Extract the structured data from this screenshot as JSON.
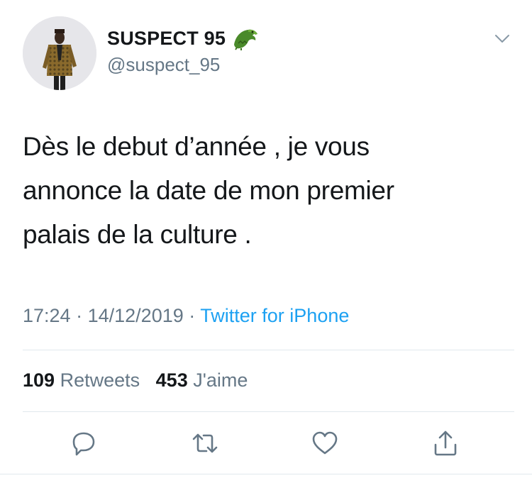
{
  "tweet": {
    "author_name": "SUSPECT 95",
    "author_emoji": "crocodile-emoji",
    "handle": "@suspect_95",
    "text_lines": [
      "Dès le debut d’année , je vous",
      "annonce la date de mon premier",
      "palais de la culture ."
    ],
    "time": "17:24",
    "date": "14/12/2019",
    "separator": "·",
    "source": "Twitter for iPhone",
    "retweets_count": "109",
    "retweets_label": "Retweets",
    "likes_count": "453",
    "likes_label": "J'aime"
  },
  "icons": {
    "menu": "chevron-down-icon",
    "reply": "reply-icon",
    "retweet": "retweet-icon",
    "like": "heart-icon",
    "share": "share-icon"
  },
  "colors": {
    "text": "#14171a",
    "secondary": "#657786",
    "link": "#1da1f2",
    "divider": "#e1e8ed"
  }
}
